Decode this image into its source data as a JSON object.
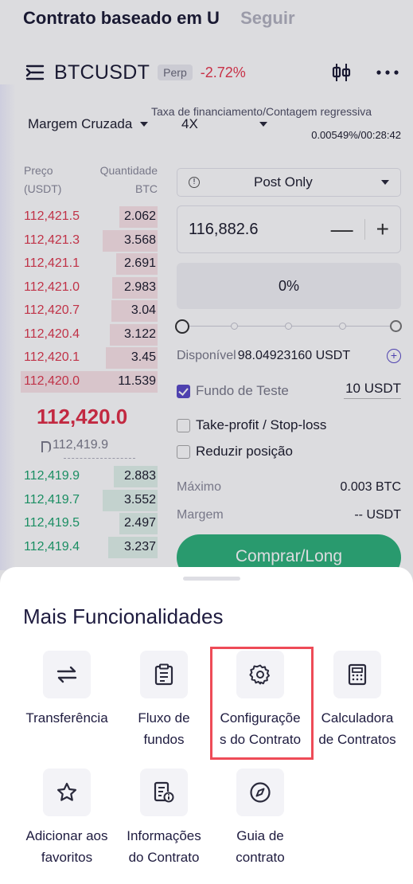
{
  "header": {
    "tab_active": "Contrato baseado em U",
    "tab_inactive": "Seguir"
  },
  "pair": {
    "symbol": "BTCUSDT",
    "badge": "Perp",
    "change": "-2.72%"
  },
  "funding": {
    "label": "Taxa de financiamento/Contagem regressiva",
    "value": "0.00549%/00:28:42"
  },
  "margin_mode": "Margem Cruzada",
  "leverage": "4X",
  "orderbook": {
    "price_header": "Preço\n(USDT)",
    "qty_header": "Quantidade\nBTC",
    "asks": [
      {
        "price": "112,421.5",
        "qty": "2.062",
        "depth": 0.28
      },
      {
        "price": "112,421.3",
        "qty": "3.568",
        "depth": 0.4
      },
      {
        "price": "112,421.1",
        "qty": "2.691",
        "depth": 0.3
      },
      {
        "price": "112,421.0",
        "qty": "2.983",
        "depth": 0.33
      },
      {
        "price": "112,420.7",
        "qty": "3.04",
        "depth": 0.34
      },
      {
        "price": "112,420.4",
        "qty": "3.122",
        "depth": 0.35
      },
      {
        "price": "112,420.1",
        "qty": "3.45",
        "depth": 0.38
      },
      {
        "price": "112,420.0",
        "qty": "11.539",
        "depth": 1.0
      }
    ],
    "last_price": "112,420.0",
    "mark_price": "112,419.9",
    "bids": [
      {
        "price": "112,419.9",
        "qty": "2.883",
        "depth": 0.32
      },
      {
        "price": "112,419.7",
        "qty": "3.552",
        "depth": 0.4
      },
      {
        "price": "112,419.5",
        "qty": "2.497",
        "depth": 0.28
      },
      {
        "price": "112,419.4",
        "qty": "3.237",
        "depth": 0.36
      }
    ]
  },
  "order": {
    "type": "Post Only",
    "price": "116,882.6",
    "qty_percent": "0%",
    "available_label": "Disponível",
    "available_value": "98.04923160 USDT",
    "test_fund_label": "Fundo de Teste",
    "test_fund_value": "10 USDT",
    "tpsl_label": "Take-profit / Stop-loss",
    "reduce_label": "Reduzir posição",
    "max_label": "Máximo",
    "max_value": "0.003 BTC",
    "margin_label": "Margem",
    "margin_value": "-- USDT",
    "buy_label": "Comprar/Long"
  },
  "sheet": {
    "title": "Mais Funcionalidades",
    "items": [
      {
        "label": "Transferência",
        "icon": "transfer-icon"
      },
      {
        "label": "Fluxo de\nfundos",
        "icon": "clipboard-icon"
      },
      {
        "label": "Configuraçõe\ns do Contrato",
        "icon": "gear-icon"
      },
      {
        "label": "Calculadora\nde Contratos",
        "icon": "calculator-icon"
      },
      {
        "label": "Adicionar aos\nfavoritos",
        "icon": "star-icon"
      },
      {
        "label": "Informações\ndo Contrato",
        "icon": "document-info-icon"
      },
      {
        "label": "Guia de\ncontrato",
        "icon": "compass-icon"
      }
    ]
  },
  "colors": {
    "ask": "#df3a4f",
    "bid": "#1fa56f",
    "accent": "#5a4bc8",
    "buy": "#2fb37c",
    "highlight": "#ee4b57"
  }
}
